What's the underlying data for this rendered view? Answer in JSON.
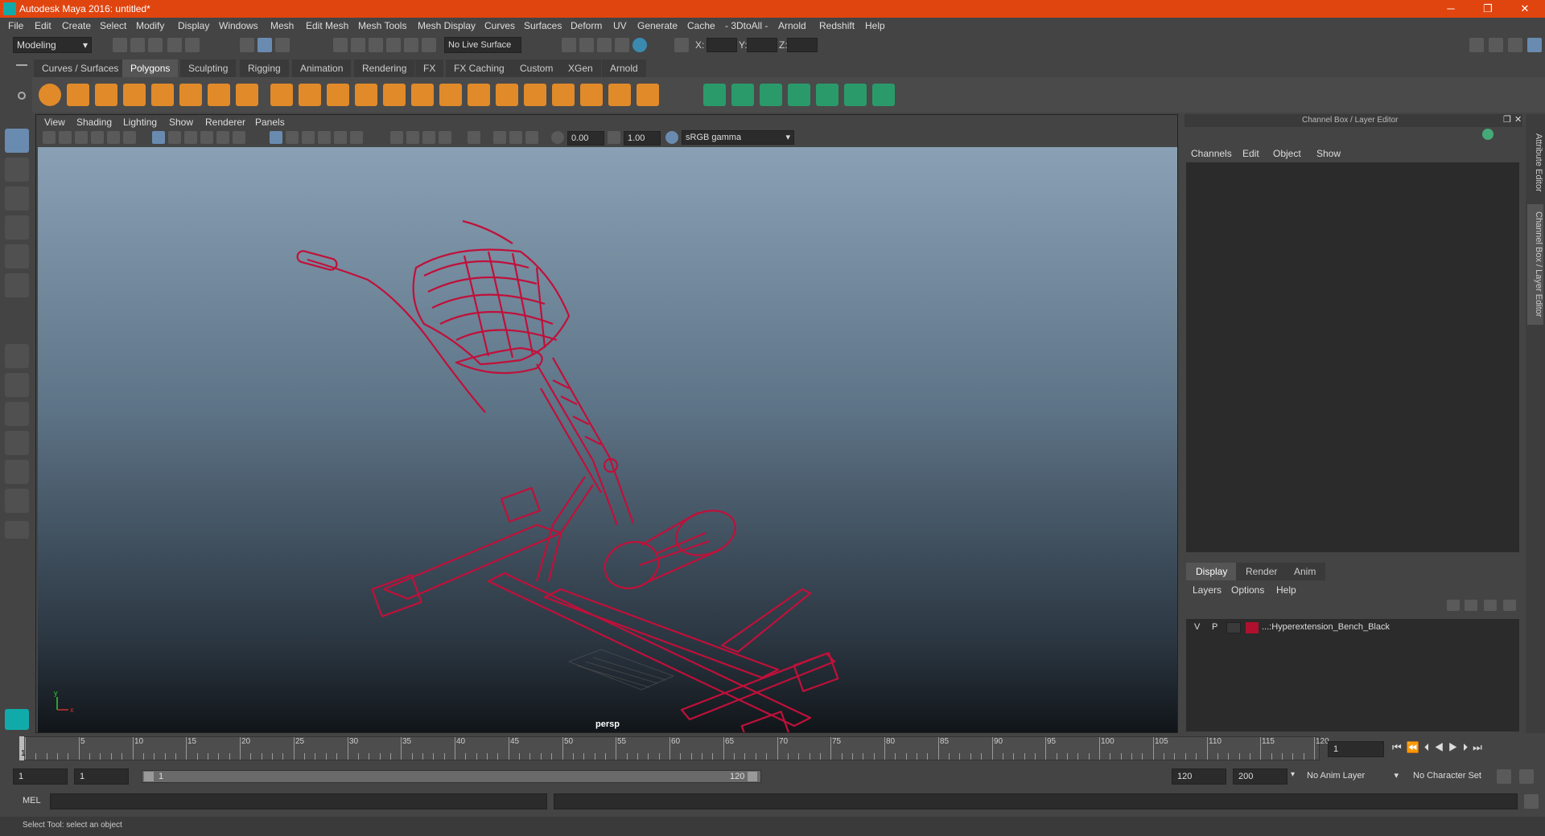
{
  "window": {
    "title": "Autodesk Maya 2016: untitled*"
  },
  "menubar": [
    "File",
    "Edit",
    "Create",
    "Select",
    "Modify",
    "Display",
    "Windows",
    "Mesh",
    "Edit Mesh",
    "Mesh Tools",
    "Mesh Display",
    "Curves",
    "Surfaces",
    "Deform",
    "UV",
    "Generate",
    "Cache",
    "- 3DtoAll -",
    "Arnold",
    "Redshift",
    "Help"
  ],
  "statusline": {
    "mode": "Modeling",
    "live_surface": "No Live Surface",
    "x_label": "X:",
    "y_label": "Y:",
    "z_label": "Z:"
  },
  "shelf": {
    "tabs": [
      "Curves / Surfaces",
      "Polygons",
      "Sculpting",
      "Rigging",
      "Animation",
      "Rendering",
      "FX",
      "FX Caching",
      "Custom",
      "XGen",
      "Arnold"
    ],
    "active": "Polygons"
  },
  "viewport": {
    "menu": [
      "View",
      "Shading",
      "Lighting",
      "Show",
      "Renderer",
      "Panels"
    ],
    "exposure": "0.00",
    "gamma": "1.00",
    "colorspace": "sRGB gamma",
    "camera": "persp",
    "axis_y": "y",
    "axis_x": "x",
    "wire_color": "#c0103a"
  },
  "channelbox": {
    "title": "Channel Box / Layer Editor",
    "menu": [
      "Channels",
      "Edit",
      "Object",
      "Show"
    ]
  },
  "layers": {
    "tabs": [
      "Display",
      "Render",
      "Anim"
    ],
    "active": "Display",
    "menu": [
      "Layers",
      "Options",
      "Help"
    ],
    "rows": [
      {
        "v": "V",
        "p": "P",
        "name": "...:Hyperextension_Bench_Black",
        "color": "#b0102e"
      }
    ]
  },
  "sidetabs": [
    "Attribute Editor",
    "Channel Box / Layer Editor"
  ],
  "timeslider": {
    "labels": [
      "5",
      "10",
      "15",
      "20",
      "25",
      "30",
      "35",
      "40",
      "45",
      "50",
      "55",
      "60",
      "65",
      "70",
      "75",
      "80",
      "85",
      "90",
      "95",
      "100",
      "105",
      "110",
      "115",
      "120"
    ],
    "current": "1",
    "current_frame": "1"
  },
  "range": {
    "start": "1",
    "playback_start": "1",
    "range_min": "1",
    "range_max": "120",
    "playback_end": "120",
    "end": "200",
    "anim_layer": "No Anim Layer",
    "char_set": "No Character Set"
  },
  "mel": {
    "label": "MEL"
  },
  "help": {
    "text": "Select Tool: select an object"
  }
}
